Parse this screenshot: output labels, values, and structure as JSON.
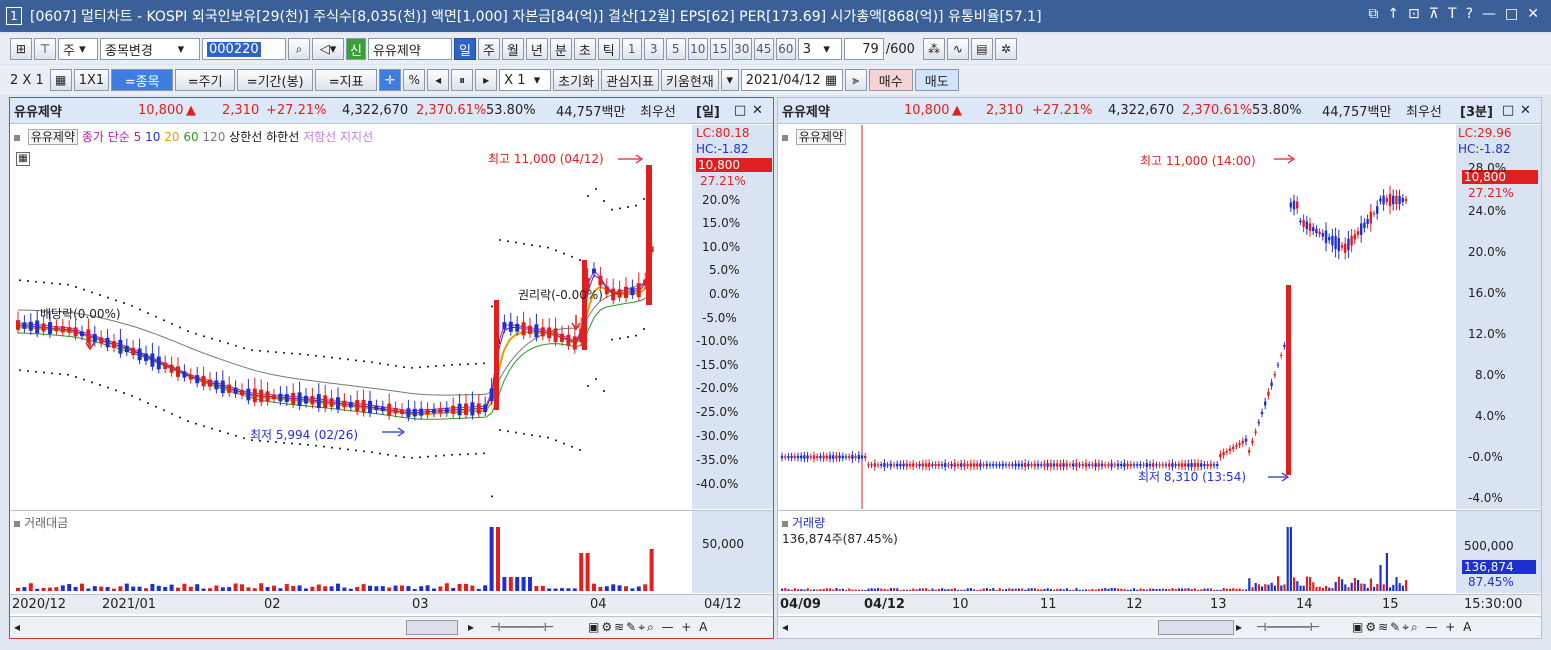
{
  "titlebar": {
    "num": "1",
    "text": "[0607] 멀티차트 - KOSPI 외국인보유[29(천)] 주식수[8,035(천)] 액면[1,000] 자본금[84(억)] 결산[12월] EPS[62] PER[173.69] 시가총액[868(억)] 유통비율[57.1]",
    "controls": [
      "⧉",
      "↑",
      "⊡",
      "⊼",
      "T",
      "?",
      "—",
      "□",
      "✕"
    ]
  },
  "toolbar1": {
    "type_select": "주",
    "stock_change": "종목변경",
    "code": "000220",
    "new_badge": "신",
    "stock_name": "유유제약",
    "periods": [
      "일",
      "주",
      "월",
      "년",
      "분",
      "초",
      "틱"
    ],
    "selected_period": "일",
    "nums": [
      "1",
      "3",
      "5",
      "10",
      "15",
      "30",
      "45",
      "60"
    ],
    "count_select": "3",
    "count": "79",
    "total": "/600"
  },
  "toolbar2": {
    "layout": "2 X 1",
    "one": "1X1",
    "btns": [
      "=종목",
      "=주기",
      "=기간(봉)",
      "=지표"
    ],
    "pct": "%",
    "mult": "X 1",
    "reset": "초기화",
    "interest": "관심지표",
    "kiwoom": "키움현재",
    "date": "2021/04/12",
    "buy": "매수",
    "sell": "매도"
  },
  "left": {
    "header": {
      "name": "유유제약",
      "price": "10,800",
      "arrow": "▲",
      "change": "2,310",
      "pct": "+27.21%",
      "volume": "4,322,670",
      "vol_pct": "2,370.61%",
      "ratio": "53.80%",
      "amount": "44,757백만",
      "best": "최우선",
      "period": "[일]"
    },
    "legend": {
      "name": "유유제약",
      "items": [
        {
          "t": "종가 단순 5",
          "c": "#b020b0"
        },
        {
          "t": "10",
          "c": "#2030d0"
        },
        {
          "t": "20",
          "c": "#e0a000"
        },
        {
          "t": "60",
          "c": "#2a9a2a"
        },
        {
          "t": "120",
          "c": "#777777"
        },
        {
          "t": "상한선",
          "c": "#111111"
        },
        {
          "t": "하한선",
          "c": "#111111"
        },
        {
          "t": "저항선",
          "c": "#c080e0"
        },
        {
          "t": "지지선",
          "c": "#c080e0"
        }
      ]
    },
    "axis": {
      "lc": "LC:80.18",
      "hc": "HC:-1.82",
      "cur_price": "10,800",
      "cur_pct": "27.21%",
      "ticks": [
        "20.0%",
        "15.0%",
        "10.0%",
        "5.0%",
        "0.0%",
        "-5.0%",
        "-10.0%",
        "-15.0%",
        "-20.0%",
        "-25.0%",
        "-30.0%",
        "-35.0%",
        "-40.0%"
      ]
    },
    "notes": {
      "high": "최고 11,000 (04/12)",
      "low": "최저 5,994 (02/26)",
      "rights1": "배당락(0.00%)",
      "rights2": "권리락(-0.00%)"
    },
    "volume": {
      "title": "거래대금",
      "tick": "50,000"
    },
    "dates": [
      "2020/12",
      "2021/01",
      "02",
      "03",
      "04"
    ],
    "date_right": "04/12"
  },
  "right": {
    "header": {
      "name": "유유제약",
      "price": "10,800",
      "arrow": "▲",
      "change": "2,310",
      "pct": "+27.21%",
      "volume": "4,322,670",
      "vol_pct": "2,370.61%",
      "ratio": "53.80%",
      "amount": "44,757백만",
      "best": "최우선",
      "period": "[3분]"
    },
    "legend": {
      "name": "유유제약"
    },
    "axis": {
      "lc": "LC:29.96",
      "hc": "HC:-1.82",
      "cur_price": "10,800",
      "cur_pct": "27.21%",
      "ticks": [
        "28.0%",
        "24.0%",
        "20.0%",
        "16.0%",
        "12.0%",
        "8.0%",
        "4.0%",
        "-0.0%",
        "-4.0%"
      ]
    },
    "notes": {
      "high": "최고 11,000 (14:00)",
      "low": "최저 8,310 (13:54)"
    },
    "volume": {
      "title": "거래량",
      "info": "136,874주(87.45%)",
      "ticks": [
        "500,000",
        "0"
      ],
      "cur": "136,874",
      "cur_pct": "87.45%"
    },
    "dates": [
      "04/09",
      "04/12",
      "10",
      "11",
      "12",
      "13",
      "14",
      "15"
    ],
    "date_right": "15:30:00"
  }
}
